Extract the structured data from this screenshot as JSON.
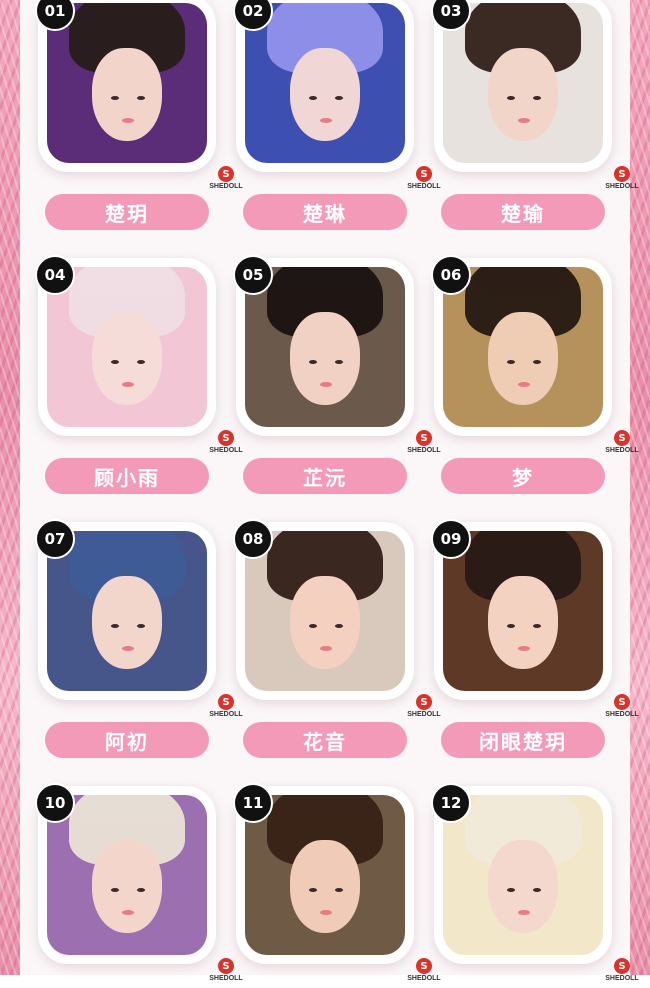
{
  "brand_logo_text": "SHEDOLL",
  "items": [
    {
      "num": "01",
      "name": "楚玥",
      "hair": "#2a1d1d",
      "skin": "#f3d4cb",
      "bg": "#5b2c78"
    },
    {
      "num": "02",
      "name": "楚琳",
      "hair": "#8c8ee8",
      "skin": "#f1d6d6",
      "bg": "#3d4fb0"
    },
    {
      "num": "03",
      "name": "楚瑜",
      "hair": "#3b2a24",
      "skin": "#f2d5c9",
      "bg": "#e8e2df"
    },
    {
      "num": "04",
      "name": "顾小雨",
      "hair": "#f0dde4",
      "skin": "#f6dcd8",
      "bg": "#f3c6d6"
    },
    {
      "num": "05",
      "name": "芷沅",
      "hair": "#1f1614",
      "skin": "#f1d1c3",
      "bg": "#6b5a4c"
    },
    {
      "num": "06",
      "name": "梦",
      "hair": "#2c1f16",
      "skin": "#efcdb5",
      "bg": "#b5925c"
    },
    {
      "num": "07",
      "name": "阿初",
      "hair": "#3f5b96",
      "skin": "#f2d6cc",
      "bg": "#46558a"
    },
    {
      "num": "08",
      "name": "花音",
      "hair": "#3a2720",
      "skin": "#f4d0c1",
      "bg": "#d9c8bc"
    },
    {
      "num": "09",
      "name": "闭眼楚玥",
      "hair": "#2a1b16",
      "skin": "#f3d2c2",
      "bg": "#5e3a26"
    },
    {
      "num": "10",
      "name": "",
      "hair": "#e6dcd4",
      "skin": "#f3d5cc",
      "bg": "#9c6fb0"
    },
    {
      "num": "11",
      "name": "",
      "hair": "#3a2418",
      "skin": "#efcbb8",
      "bg": "#6f5b45"
    },
    {
      "num": "12",
      "name": "",
      "hair": "#f1ead8",
      "skin": "#f4d8cd",
      "bg": "#f2e7c8"
    }
  ]
}
